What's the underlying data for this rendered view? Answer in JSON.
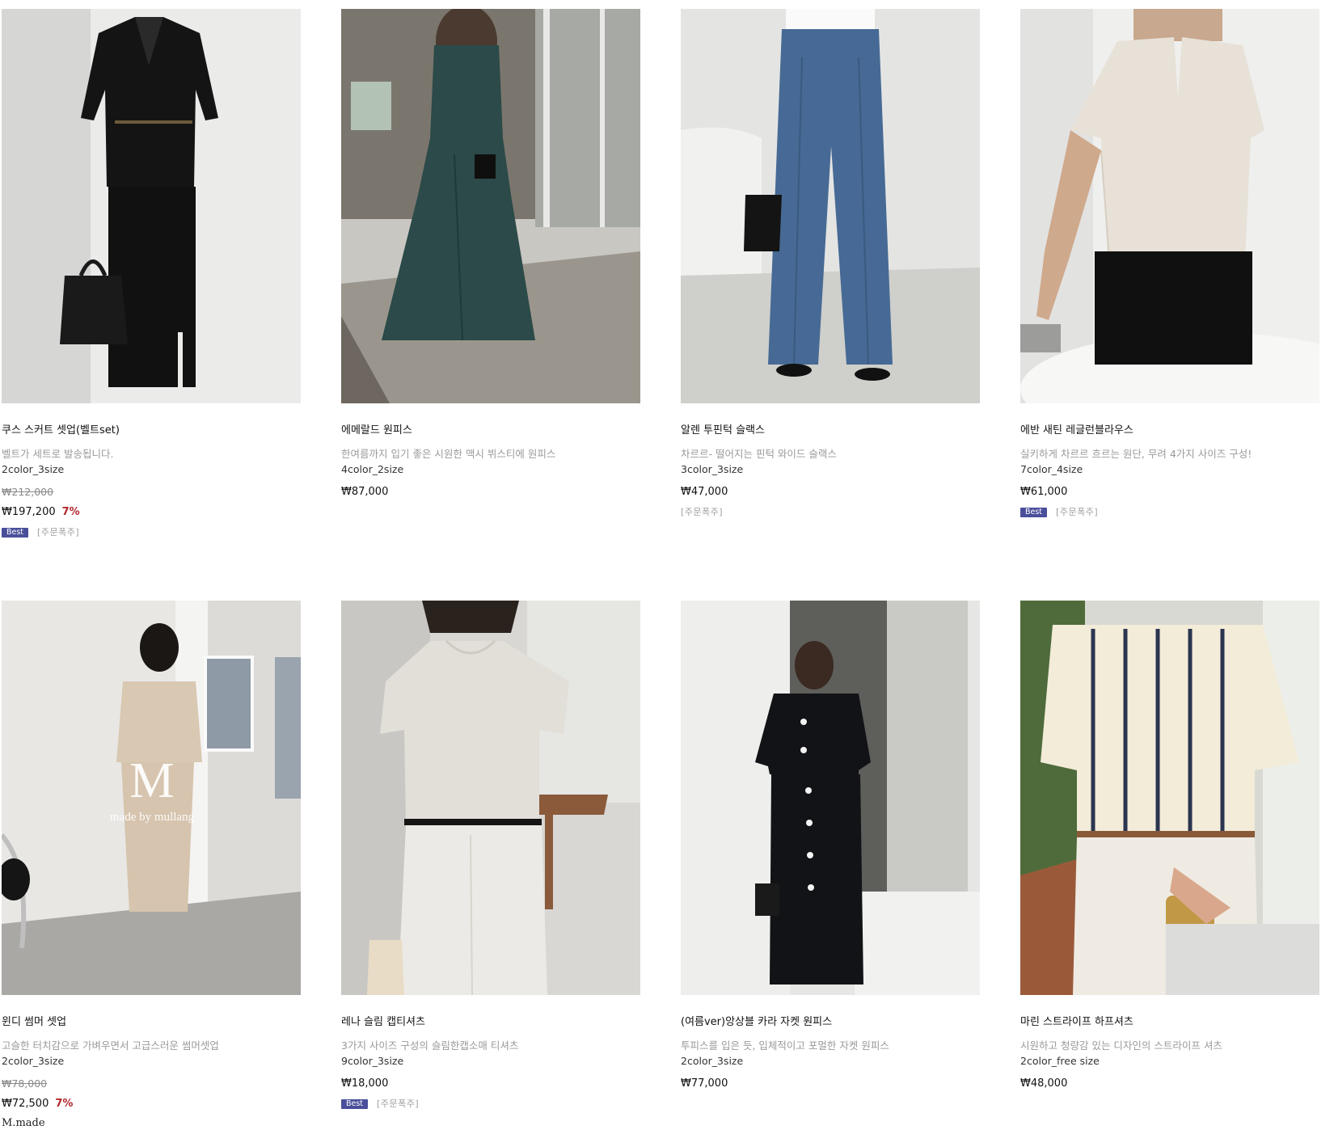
{
  "products": [
    {
      "name": "쿠스 스커트 셋업(벨트set)",
      "desc": "벨트가 세트로 발송됩니다.",
      "options": "2color_3size",
      "original_price": "₩212,000",
      "price": "₩197,200",
      "discount": "7%",
      "badges": {
        "best": "Best",
        "order": "[주문폭주]"
      },
      "image_icon": "black-belted-jacket-skirt-photo-icon",
      "colors": {
        "bg": "#ebebea",
        "garment": "#141414"
      }
    },
    {
      "name": "에메랄드 원피스",
      "desc": "한여름까지 입기 좋은 시원한 맥시 뷔스티에 원피스",
      "options": "4color_2size",
      "price": "₩87,000",
      "image_icon": "emerald-maxi-dress-photo-icon",
      "colors": {
        "bg": "#c9c7c2",
        "garment": "#2b4a49"
      }
    },
    {
      "name": "알렌 투핀턱 슬랙스",
      "desc": "차르르- 떨어지는 핀턱 와이드 슬랙스",
      "options": "3color_3size",
      "price": "₩47,000",
      "badges": {
        "order": "[주문폭주]"
      },
      "image_icon": "blue-wide-slacks-photo-icon",
      "colors": {
        "bg": "#e4e5e3",
        "garment": "#466a95"
      }
    },
    {
      "name": "에반 새틴 레글런블라우스",
      "desc": "실키하게 차르르 흐르는 원단, 무려 4가지 사이즈 구성!",
      "options": "7color_4size",
      "price": "₩61,000",
      "badges": {
        "best": "Best",
        "order": "[주문폭주]"
      },
      "image_icon": "ivory-satin-blouse-photo-icon",
      "colors": {
        "bg": "#efefee",
        "garment": "#e7e1d7"
      }
    },
    {
      "name": "윈디 썸머 셋업",
      "desc": "고슬한 터치감으로 가벼우면서 고급스러운 썸머셋업",
      "options": "2color_3size",
      "original_price": "₩78,000",
      "price": "₩72,500",
      "discount": "7%",
      "brand": "M.made",
      "watermark": {
        "letter": "M",
        "text": "made by mullang"
      },
      "image_icon": "beige-vest-skirt-setup-photo-icon",
      "colors": {
        "bg": "#dcdbd8",
        "garment": "#d9c8b2"
      }
    },
    {
      "name": "레나 슬림 캡티셔츠",
      "desc": "3가지 사이즈 구성의 슬림한캡소매 티셔츠",
      "options": "9color_3size",
      "price": "₩18,000",
      "badges": {
        "best": "Best",
        "order": "[주문폭주]"
      },
      "image_icon": "cap-sleeve-tshirt-photo-icon",
      "colors": {
        "bg": "#d8d7d4",
        "garment": "#e2ded8"
      }
    },
    {
      "name": "(여름ver)앙상블 카라 자켓 원피스",
      "desc": "투피스를 입은 듯, 입체적이고 포멀한 자켓 원피스",
      "options": "2color_3size",
      "price": "₩77,000",
      "image_icon": "black-collar-jacket-dress-photo-icon",
      "colors": {
        "bg": "#e6e6e4",
        "garment": "#121317"
      }
    },
    {
      "name": "마린 스트라이프 하프셔츠",
      "desc": "시원하고 청량감 있는 디자인의 스트라이프 셔츠",
      "options": "2color_free size",
      "price": "₩48,000",
      "image_icon": "striped-half-shirt-photo-icon",
      "colors": {
        "bg": "#d7d9d2",
        "garment": "#f2ecd9"
      }
    }
  ]
}
